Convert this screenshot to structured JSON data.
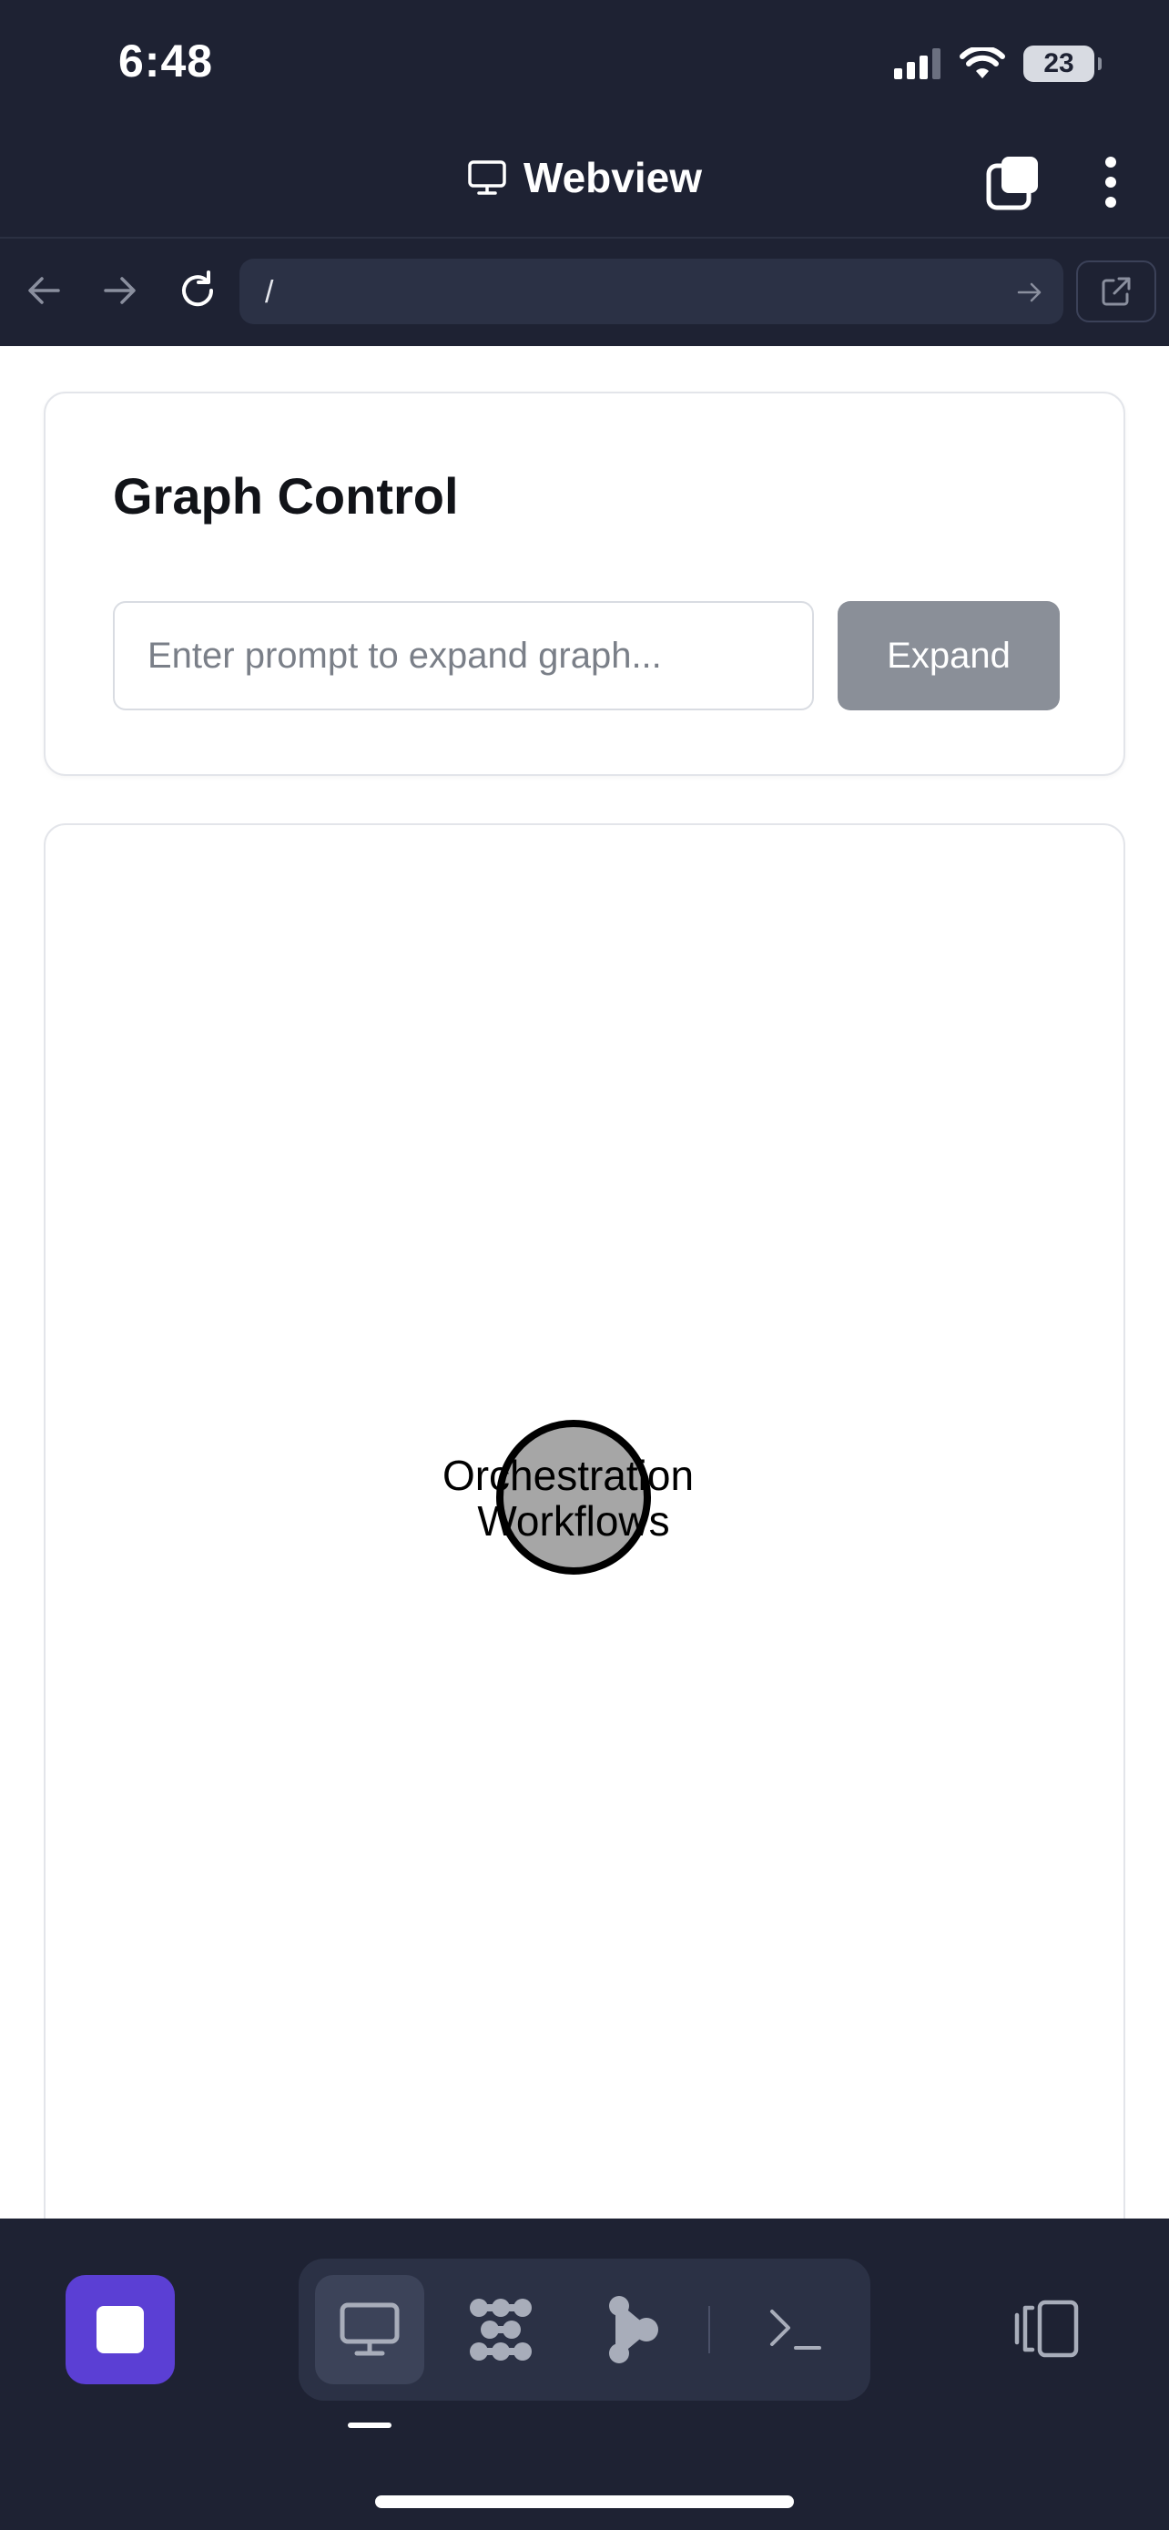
{
  "status_bar": {
    "time": "6:48",
    "battery": "23",
    "signal_icon": "cellular-signal-icon",
    "wifi_icon": "wifi-icon"
  },
  "header": {
    "title": "Webview",
    "title_icon": "monitor-icon",
    "tabs_icon": "tabs-icon",
    "menu_icon": "more-vertical-icon"
  },
  "url_bar": {
    "url": "/",
    "back_icon": "arrow-left-icon",
    "forward_icon": "arrow-right-icon",
    "reload_icon": "reload-icon",
    "go_icon": "arrow-right-icon",
    "external_icon": "external-link-icon"
  },
  "graph_control": {
    "title": "Graph Control",
    "input_placeholder": "Enter prompt to expand graph...",
    "input_value": "",
    "expand_label": "Expand"
  },
  "graph": {
    "nodes": [
      {
        "label_lines": [
          "Orchestration",
          "Workflows"
        ],
        "fill": "#a6a6a6",
        "stroke": "#000000"
      }
    ]
  },
  "bottom_toolbar": {
    "stop_icon": "stop-icon",
    "modes": [
      {
        "icon": "monitor-icon",
        "active": true
      },
      {
        "icon": "grid-dots-icon",
        "active": false
      },
      {
        "icon": "branch-icon",
        "active": false
      },
      {
        "icon": "terminal-icon",
        "active": false
      }
    ],
    "device_toggle_icon": "device-toggle-icon"
  },
  "colors": {
    "chrome_bg": "#1e2233",
    "url_field_bg": "#2b3145",
    "accent": "#5b3fd4",
    "expand_button": "#8a8f98"
  }
}
